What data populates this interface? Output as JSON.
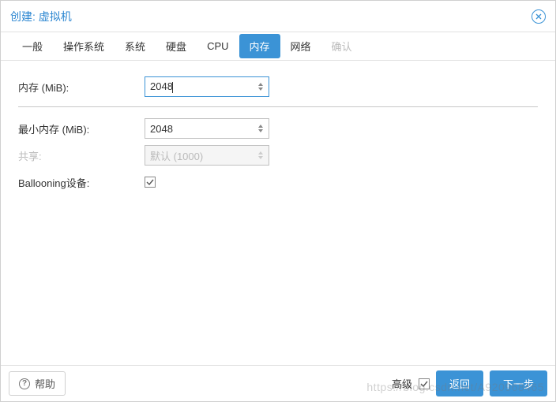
{
  "title": "创建: 虚拟机",
  "tabs": {
    "general": "一般",
    "os": "操作系统",
    "system": "系统",
    "disk": "硬盘",
    "cpu": "CPU",
    "memory": "内存",
    "network": "网络",
    "confirm": "确认"
  },
  "form": {
    "memory_label": "内存 (MiB):",
    "memory_value": "2048",
    "min_memory_label": "最小内存 (MiB):",
    "min_memory_value": "2048",
    "shares_label": "共享:",
    "shares_placeholder": "默认 (1000)",
    "ballooning_label": "Ballooning设备:"
  },
  "footer": {
    "help": "帮助",
    "advanced_label": "高级",
    "back": "返回",
    "next": "下一步"
  },
  "watermark": "https://blog.csdn.net/A920968465"
}
